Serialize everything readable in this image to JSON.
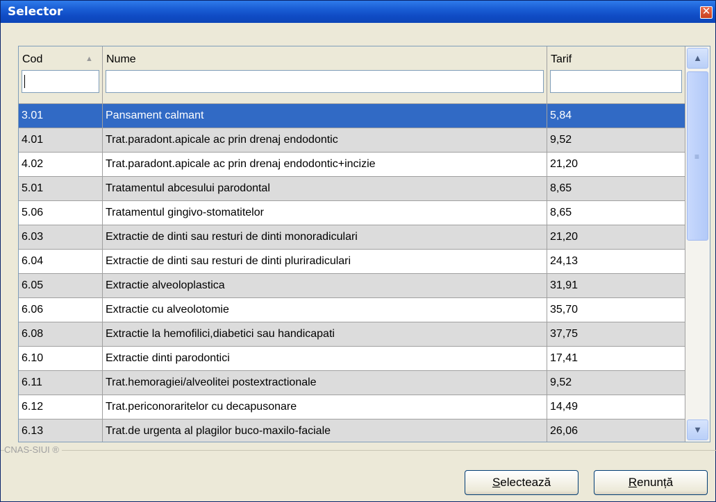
{
  "window": {
    "title": "Selector"
  },
  "grid": {
    "columns": [
      {
        "label": "Cod"
      },
      {
        "label": "Nume"
      },
      {
        "label": "Tarif"
      }
    ],
    "filters": {
      "cod": "",
      "nume": "",
      "tarif": ""
    },
    "selected_row": 0,
    "rows": [
      {
        "cod": "3.01",
        "nume": "Pansament calmant",
        "tarif": "5,84"
      },
      {
        "cod": "4.01",
        "nume": "Trat.paradont.apicale ac prin drenaj endodontic",
        "tarif": "9,52"
      },
      {
        "cod": "4.02",
        "nume": "Trat.paradont.apicale ac prin drenaj endodontic+incizie",
        "tarif": "21,20"
      },
      {
        "cod": "5.01",
        "nume": "Tratamentul abcesului parodontal",
        "tarif": "8,65"
      },
      {
        "cod": "5.06",
        "nume": "Tratamentul gingivo-stomatitelor",
        "tarif": "8,65"
      },
      {
        "cod": "6.03",
        "nume": "Extractie de dinti sau resturi de dinti monoradiculari",
        "tarif": "21,20"
      },
      {
        "cod": "6.04",
        "nume": "Extractie de dinti sau resturi de dinti pluriradiculari",
        "tarif": "24,13"
      },
      {
        "cod": "6.05",
        "nume": "Extractie alveoloplastica",
        "tarif": "31,91"
      },
      {
        "cod": "6.06",
        "nume": "Extractie cu alveolotomie",
        "tarif": "35,70"
      },
      {
        "cod": "6.08",
        "nume": "Extractie la hemofilici,diabetici sau handicapati",
        "tarif": "37,75"
      },
      {
        "cod": "6.10",
        "nume": "Extractie dinti parodontici",
        "tarif": "17,41"
      },
      {
        "cod": "6.11",
        "nume": "Trat.hemoragiei/alveolitei postextractionale",
        "tarif": "9,52"
      },
      {
        "cod": "6.12",
        "nume": "Trat.periconoraritelor cu decapusonare",
        "tarif": "14,49"
      },
      {
        "cod": "6.13",
        "nume": "Trat.de urgenta al plagilor buco-maxilo-faciale",
        "tarif": "26,06"
      }
    ]
  },
  "footer": {
    "brand": "CNAS-SIUI ®",
    "select_button": {
      "accel": "S",
      "rest": "electează"
    },
    "cancel_button": {
      "accel": "R",
      "rest": "enunță"
    }
  },
  "icons": {
    "close": "close-icon",
    "sort": "sort-ascending-icon",
    "scroll_up": "chevron-up-icon",
    "scroll_down": "chevron-down-icon",
    "thumb_grip": "grip-icon"
  },
  "colors": {
    "titlebar": "#0f4bc4",
    "selection": "#316ac5",
    "alt_row": "#dcdcdc",
    "face": "#ece9d8"
  }
}
